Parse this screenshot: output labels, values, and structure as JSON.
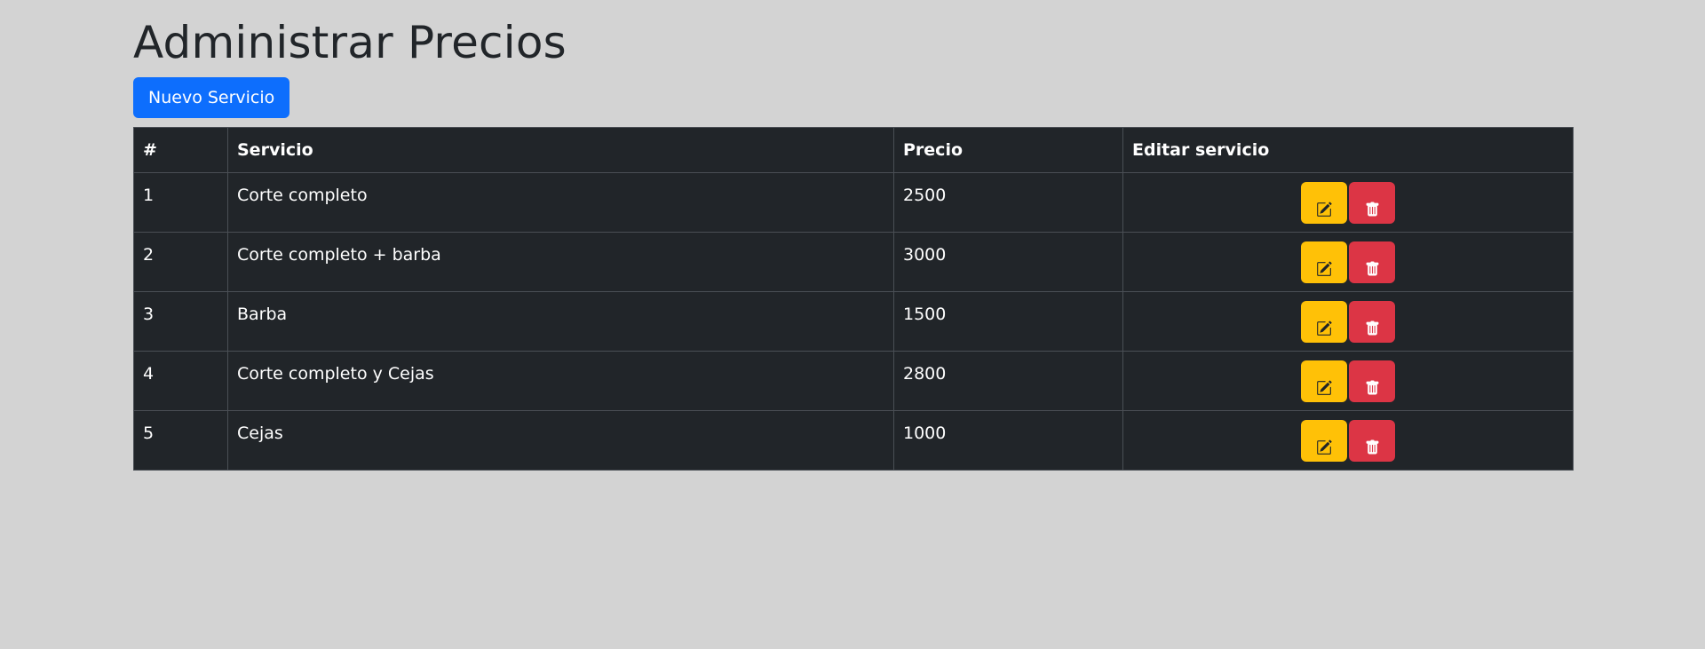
{
  "page": {
    "title": "Administrar Precios",
    "new_button_label": "Nuevo Servicio"
  },
  "table": {
    "headers": [
      "#",
      "Servicio",
      "Precio",
      "Editar servicio"
    ],
    "rows": [
      {
        "id": "1",
        "servicio": "Corte completo",
        "precio": "2500"
      },
      {
        "id": "2",
        "servicio": "Corte completo + barba",
        "precio": "3000"
      },
      {
        "id": "3",
        "servicio": "Barba",
        "precio": "1500"
      },
      {
        "id": "4",
        "servicio": "Corte completo y Cejas",
        "precio": "2800"
      },
      {
        "id": "5",
        "servicio": "Cejas",
        "precio": "1000"
      }
    ]
  },
  "icons": {
    "edit": "edit-icon",
    "delete": "trash-icon"
  },
  "colors": {
    "background": "#d3d3d3",
    "primary": "#0d6efd",
    "warning": "#ffc107",
    "danger": "#dc3545",
    "table_dark": "#212529"
  }
}
